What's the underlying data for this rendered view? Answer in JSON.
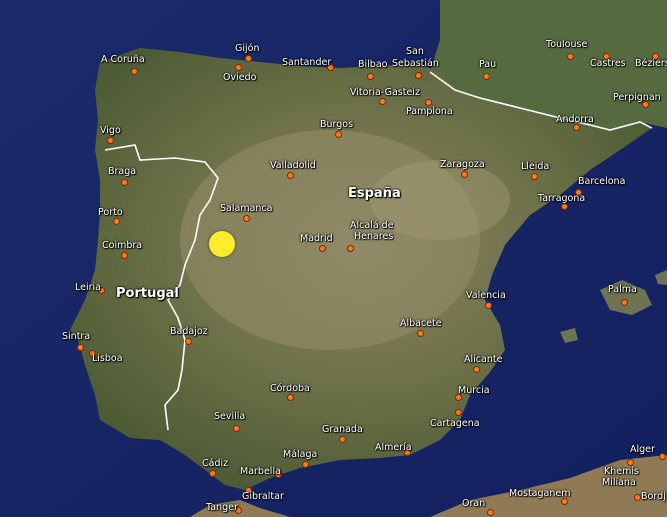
{
  "map": {
    "colors": {
      "sea": "#1b2a6e",
      "land": "#5b6a3c",
      "land_light": "#8d8a66",
      "border": "#ffffff",
      "city_dot": "#ff7a1a",
      "marker": "#ffec2e"
    },
    "icons": {
      "city": "orange-dot-icon",
      "marker": "yellow-circle-marker-icon"
    },
    "countries": {
      "spain": "España",
      "portugal": "Portugal"
    },
    "cities": {
      "a_coruna": "A Coruña",
      "gijon": "Gijón",
      "oviedo": "Oviedo",
      "santander": "Santander",
      "bilbao": "Bilbao",
      "san_sebastian_1": "San",
      "san_sebastian_2": "Sebastián",
      "toulouse": "Toulouse",
      "pau": "Pau",
      "castres": "Castres",
      "beziers": "Béziers",
      "perpignan": "Perpignan",
      "vigo": "Vigo",
      "vitoria": "Vitoria-Gasteiz",
      "burgos": "Burgos",
      "pamplona": "Pamplona",
      "andorra": "Andorra",
      "braga": "Braga",
      "valladolid": "Valladolid",
      "zaragoza": "Zaragoza",
      "lleida": "Lleida",
      "barcelona": "Barcelona",
      "porto": "Porto",
      "salamanca": "Salamanca",
      "tarragona": "Tarragona",
      "madrid": "Madrid",
      "alcala_1": "Alcalá de",
      "alcala_2": "Henares",
      "coimbra": "Coimbra",
      "leiria": "Leiria",
      "valencia": "Valencia",
      "palma": "Palma",
      "badajoz": "Badajoz",
      "albacete": "Albacete",
      "sintra": "Sintra",
      "lisboa": "Lisboa",
      "alicante": "Alicante",
      "cordoba": "Córdoba",
      "murcia": "Murcia",
      "sevilla": "Sevilla",
      "cartagena": "Cartagena",
      "granada": "Granada",
      "almeria": "Almería",
      "malaga": "Málaga",
      "marbella": "Marbella",
      "cadiz": "Cádiz",
      "gibraltar": "Gibraltar",
      "tanger": "Tanger",
      "alger": "Alger",
      "khemis_1": "Khemis",
      "khemis_2": "Miliana",
      "oran": "Oran",
      "mostaganem": "Mostaganem",
      "bordj": "Bordj"
    }
  }
}
